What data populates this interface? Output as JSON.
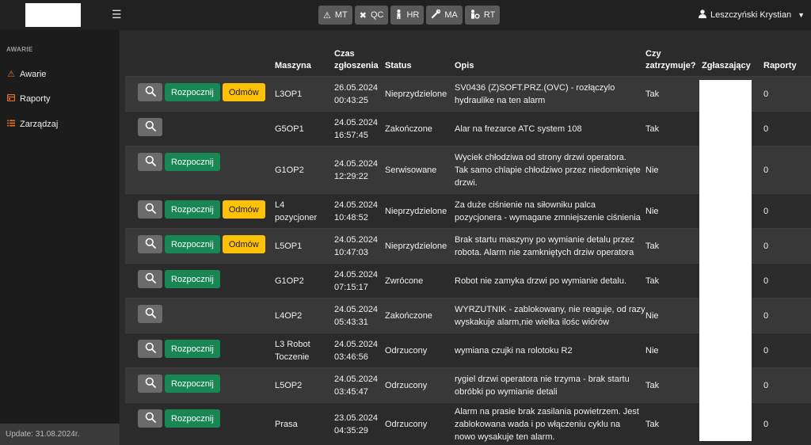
{
  "topbar": {
    "modules": [
      {
        "label": "MT",
        "icon": "warning-icon"
      },
      {
        "label": "QC",
        "icon": "tools-icon"
      },
      {
        "label": "HR",
        "icon": "person-icon"
      },
      {
        "label": "MA",
        "icon": "wrench-icon"
      },
      {
        "label": "RT",
        "icon": "person-gear-icon"
      }
    ],
    "user_name": "Leszczyński Krystian"
  },
  "sidebar": {
    "header": "AWARIE",
    "items": [
      {
        "label": "Awarie",
        "icon": "warning-icon"
      },
      {
        "label": "Raporty",
        "icon": "report-icon"
      },
      {
        "label": "Zarządzaj",
        "icon": "list-icon"
      }
    ],
    "update": "Update: 31.08.2024r."
  },
  "table": {
    "headers": {
      "machine": "Maszyna",
      "time_1": "Czas",
      "time_2": "zgłoszenia",
      "status": "Status",
      "desc": "Opis",
      "stop_1": "Czy",
      "stop_2": "zatrzymuje?",
      "reporter": "Zgłaszający",
      "reports": "Raporty"
    },
    "labels": {
      "start": "Rozpocznij",
      "refuse": "Odmów"
    },
    "rows": [
      {
        "machine": [
          "L3OP1"
        ],
        "date": "26.05.2024",
        "time": "00:43:25",
        "status": "Nieprzydzielone",
        "desc": [
          "SV0436 (Z)SOFT.PRZ.(OVC) - rozłączylo",
          "hydraulike na ten alarm"
        ],
        "stop": "Tak",
        "reports": "0",
        "start": true,
        "refuse": true
      },
      {
        "machine": [
          "G5OP1"
        ],
        "date": "24.05.2024",
        "time": "16:57:45",
        "status": "Zakończone",
        "desc": [
          "Alar na frezarce ATC system 108"
        ],
        "stop": "Tak",
        "reports": "0",
        "start": false,
        "refuse": false
      },
      {
        "machine": [
          "G1OP2"
        ],
        "date": "24.05.2024",
        "time": "12:29:22",
        "status": "Serwisowane",
        "desc": [
          "Wyciek chłodziwa od strony drzwi operatora.",
          "Tak samo chlapie chłodziwo przez niedomknięte",
          "drzwi."
        ],
        "stop": "Nie",
        "reports": "0",
        "start": true,
        "refuse": false
      },
      {
        "machine": [
          "L4",
          "pozycjoner"
        ],
        "date": "24.05.2024",
        "time": "10:48:52",
        "status": "Nieprzydzielone",
        "desc": [
          "Za duże ciśnienie na siłowniku palca",
          "pozycjonera - wymagane zmniejszenie ciśnienia"
        ],
        "stop": "Nie",
        "reports": "0",
        "start": true,
        "refuse": true
      },
      {
        "machine": [
          "L5OP1"
        ],
        "date": "24.05.2024",
        "time": "10:47:03",
        "status": "Nieprzydzielone",
        "desc": [
          "Brak startu maszyny po wymianie detalu przez",
          "robota. Alarm nie zamkniętych drziw operatora"
        ],
        "stop": "Tak",
        "reports": "0",
        "start": true,
        "refuse": true
      },
      {
        "machine": [
          "G1OP2"
        ],
        "date": "24.05.2024",
        "time": "07:15:17",
        "status": "Zwrócone",
        "desc": [
          "Robot nie zamyka drzwi po wymianie detalu."
        ],
        "stop": "Tak",
        "reports": "0",
        "start": true,
        "refuse": false
      },
      {
        "machine": [
          "L4OP2"
        ],
        "date": "24.05.2024",
        "time": "05:43:31",
        "status": "Zakończone",
        "desc": [
          "WYRZUTNIK - zablokowany, nie reaguje, od razy",
          "wyskakuje alarm,nie wielka ilośc wiórów"
        ],
        "stop": "Nie",
        "reports": "0",
        "start": false,
        "refuse": false
      },
      {
        "machine": [
          "L3 Robot",
          "Toczenie"
        ],
        "date": "24.05.2024",
        "time": "03:46:56",
        "status": "Odrzucony",
        "desc": [
          "wymiana czujki na rolotoku R2"
        ],
        "stop": "Nie",
        "reports": "0",
        "start": true,
        "refuse": false
      },
      {
        "machine": [
          "L5OP2"
        ],
        "date": "24.05.2024",
        "time": "03:45:47",
        "status": "Odrzucony",
        "desc": [
          "rygiel drzwi operatora nie trzyma - brak startu",
          "obróbki po wymianie detali"
        ],
        "stop": "Tak",
        "reports": "0",
        "start": true,
        "refuse": false
      },
      {
        "machine": [
          "Prasa"
        ],
        "date": "23.05.2024",
        "time": "04:35:29",
        "status": "Odrzucony",
        "desc": [
          "Alarm na prasie brak zasilania powietrzem. Jest",
          "zablokowana wada i po włączeniu cyklu na",
          "nowo wysakuje ten alarm."
        ],
        "stop": "Tak",
        "reports": "0",
        "start": true,
        "refuse": false
      }
    ]
  }
}
